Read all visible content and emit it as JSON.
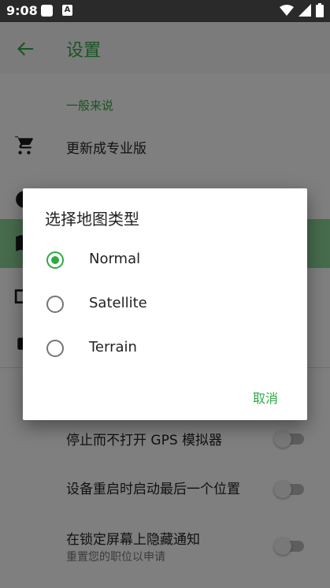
{
  "status_bar": {
    "time": "9:08",
    "notif_icon_letter": "A"
  },
  "app_bar": {
    "title": "设置"
  },
  "settings": {
    "section_title": "一般来说",
    "upgrade_label": "更新成专业版",
    "stop_gps_label": "停止而不打开 GPS 模拟器",
    "restart_label": "设备重启时启动最后一个位置",
    "lockscreen_label": "在锁定屏幕上隐藏通知",
    "lockscreen_sub": "重置您的职位以申请"
  },
  "dialog": {
    "title": "选择地图类型",
    "options": [
      {
        "label": "Normal",
        "selected": true
      },
      {
        "label": "Satellite",
        "selected": false
      },
      {
        "label": "Terrain",
        "selected": false
      }
    ],
    "cancel_label": "取消"
  },
  "colors": {
    "accent": "#2eaa45",
    "status_bar": "#2a2a2a"
  }
}
